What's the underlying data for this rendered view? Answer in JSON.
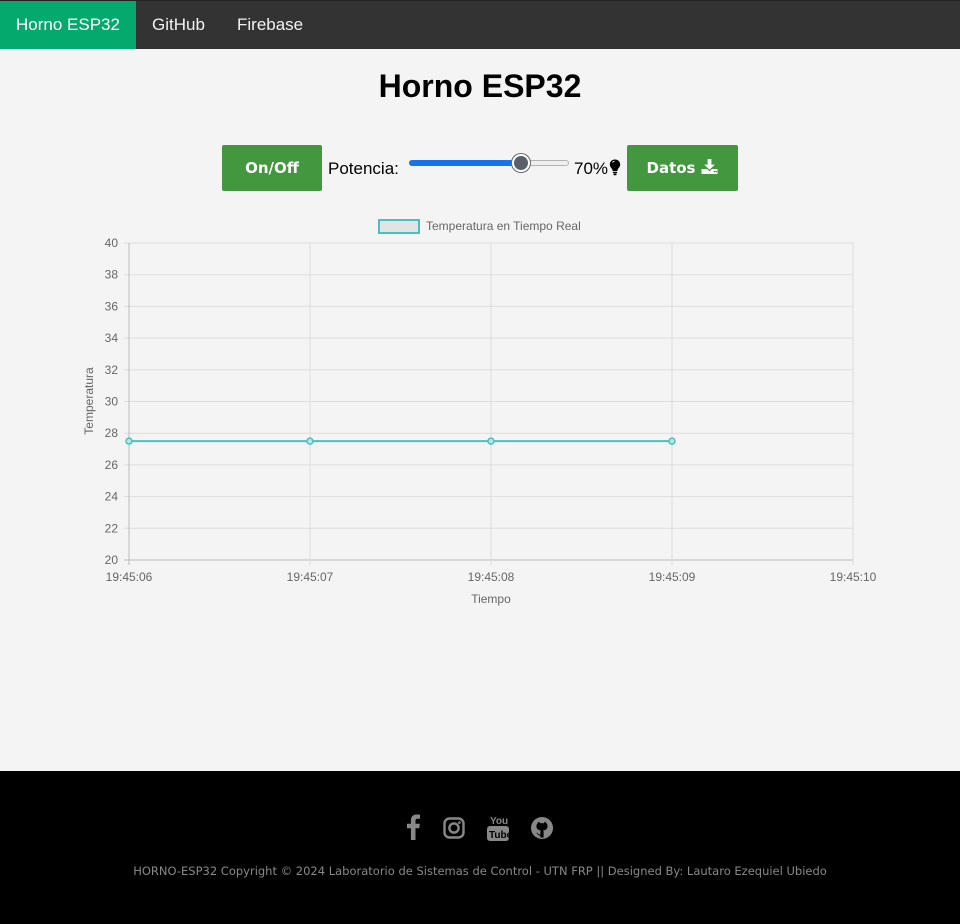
{
  "nav": {
    "brand": "Horno ESP32",
    "items": [
      {
        "label": "GitHub"
      },
      {
        "label": "Firebase"
      }
    ],
    "active_color": "#04AA6D"
  },
  "page": {
    "title": "Horno ESP32"
  },
  "controls": {
    "onoff_label": "On/Off",
    "potencia_label": "Potencia:",
    "potencia_value": 70,
    "potencia_text": "70%",
    "datos_label": "Datos",
    "button_color": "#43973f",
    "icons": [
      "lightbulb-icon",
      "download-icon"
    ]
  },
  "chart_data": {
    "type": "line",
    "legend": [
      "Temperatura en Tiempo Real"
    ],
    "legend_position": "top",
    "series": [
      {
        "name": "Temperatura en Tiempo Real",
        "color": "#4bc0c0",
        "x": [
          "19:45:06",
          "19:45:07",
          "19:45:08",
          "19:45:09"
        ],
        "values": [
          27.5,
          27.5,
          27.5,
          27.5
        ]
      }
    ],
    "x_ticks": [
      "19:45:06",
      "19:45:07",
      "19:45:08",
      "19:45:09",
      "19:45:10"
    ],
    "ylim": [
      20,
      40
    ],
    "y_ticks": [
      20,
      22,
      24,
      26,
      28,
      30,
      32,
      34,
      36,
      38,
      40
    ],
    "xlabel": "Tiempo",
    "ylabel": "Temperatura",
    "grid": true
  },
  "footer": {
    "social_icons": [
      "facebook-icon",
      "instagram-icon",
      "youtube-icon",
      "github-icon"
    ],
    "copyright": "HORNO-ESP32 Copyright © 2024 Laboratorio de Sistemas de Control - UTN FRP || Designed By: Lautaro Ezequiel Ubiedo"
  }
}
